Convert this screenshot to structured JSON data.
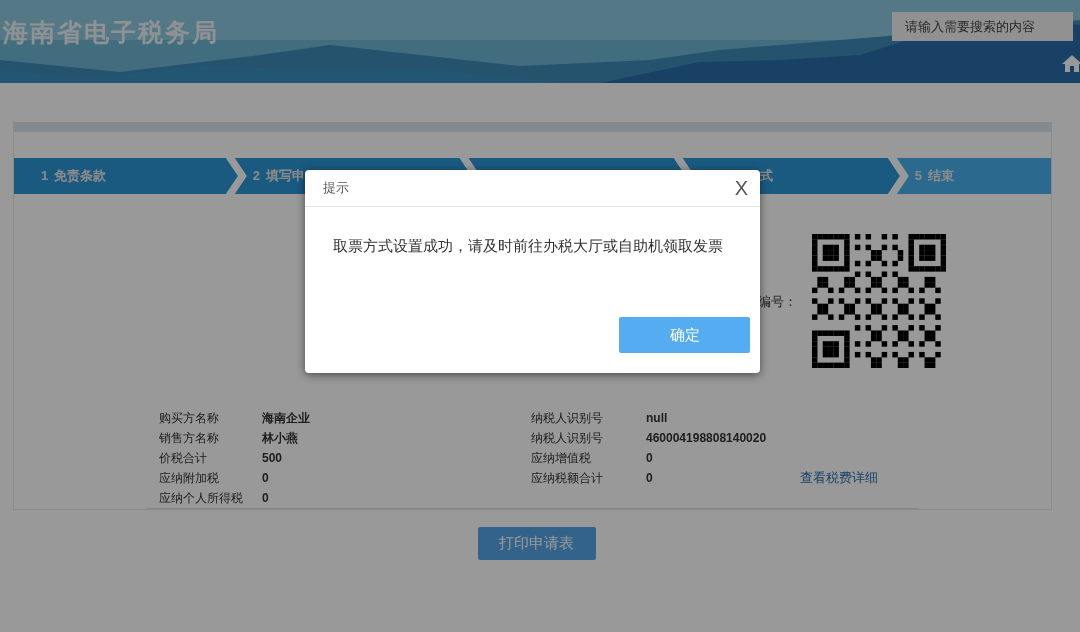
{
  "header": {
    "title": "海南省电子税务局",
    "search": {
      "placeholder": "请输入需要搜索的内容"
    }
  },
  "steps": [
    {
      "number": "1",
      "label": "免责条款",
      "completed": true
    },
    {
      "number": "2",
      "label": "填写申",
      "completed": true
    },
    {
      "completed": true
    },
    {
      "label": "式",
      "completed": true
    },
    {
      "number": "5",
      "label": "结束",
      "completed": false
    }
  ],
  "qr_label": "编号：",
  "info": {
    "left": [
      {
        "label": "购买方名称",
        "value": "海南企业"
      },
      {
        "label": "销售方名称",
        "value": "林小燕"
      },
      {
        "label": "价税合计",
        "value": "500"
      },
      {
        "label": "应纳附加税",
        "value": "0"
      },
      {
        "label": "应纳个人所得税",
        "value": "0"
      }
    ],
    "right": [
      {
        "label": "纳税人识别号",
        "value": "null"
      },
      {
        "label": "纳税人识别号",
        "value": "460004198808140020"
      },
      {
        "label": "应纳增值税",
        "value": "0"
      },
      {
        "label": "应纳税额合计",
        "value": "0"
      }
    ]
  },
  "detail_link": "查看税费详细",
  "print_button": "打印申请表",
  "dialog": {
    "title": "提示",
    "close": "X",
    "message": "取票方式设置成功，请及时前往办税大厅或自助机领取发票",
    "confirm": "确定"
  }
}
